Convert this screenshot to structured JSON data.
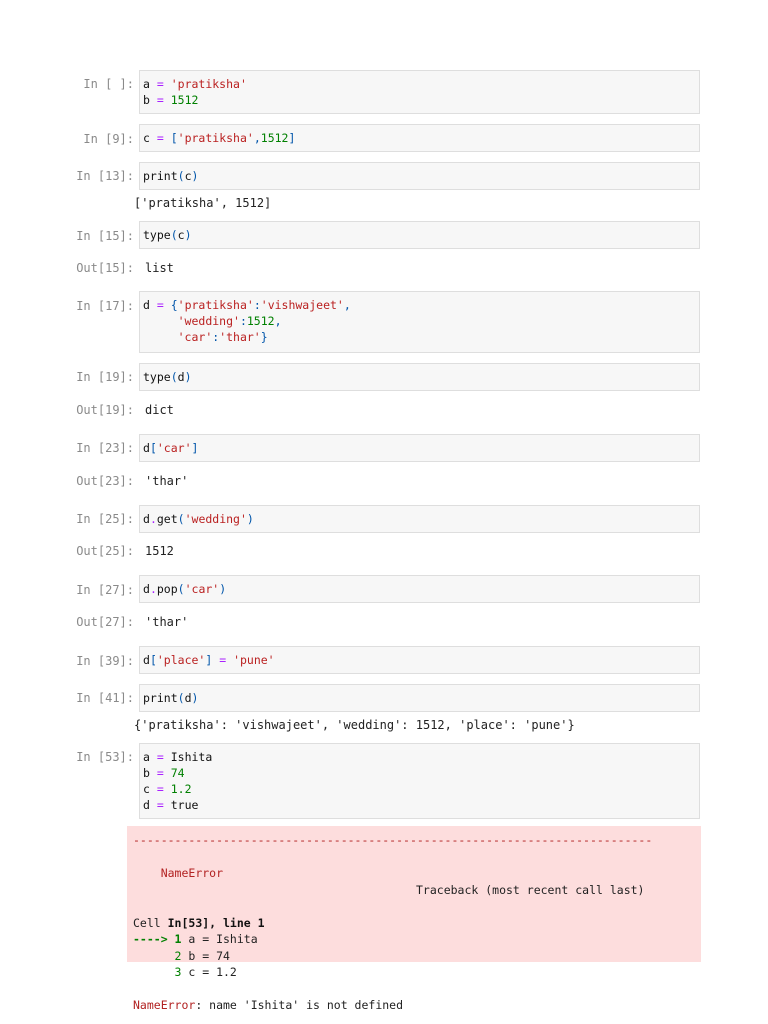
{
  "cells": [
    {
      "id": "c1",
      "prompt": "In [ ]:",
      "lines": [
        [
          {
            "t": "a",
            "c": "var"
          },
          {
            "t": " = ",
            "c": "op"
          },
          {
            "t": "'pratiksha'",
            "c": "str"
          }
        ],
        [
          {
            "t": "b",
            "c": "var"
          },
          {
            "t": " = ",
            "c": "op"
          },
          {
            "t": "1512",
            "c": "num"
          }
        ]
      ]
    },
    {
      "id": "c2",
      "prompt": "In [9]:",
      "lines": [
        [
          {
            "t": "c",
            "c": "var"
          },
          {
            "t": " = ",
            "c": "op"
          },
          {
            "t": "[",
            "c": "punc"
          },
          {
            "t": "'pratiksha'",
            "c": "str"
          },
          {
            "t": ",",
            "c": "punc"
          },
          {
            "t": "1512",
            "c": "num"
          },
          {
            "t": "]",
            "c": "punc"
          }
        ]
      ]
    },
    {
      "id": "c3",
      "prompt": "In [13]:",
      "lines": [
        [
          {
            "t": "print",
            "c": "fn"
          },
          {
            "t": "(",
            "c": "punc"
          },
          {
            "t": "c",
            "c": "var"
          },
          {
            "t": ")",
            "c": "punc"
          }
        ]
      ],
      "output": "['pratiksha', 1512]"
    },
    {
      "id": "c4",
      "prompt": "In [15]:",
      "lines": [
        [
          {
            "t": "type",
            "c": "fn"
          },
          {
            "t": "(",
            "c": "punc"
          },
          {
            "t": "c",
            "c": "var"
          },
          {
            "t": ")",
            "c": "punc"
          }
        ]
      ],
      "out_prompt": "Out[15]:",
      "output": "list"
    },
    {
      "id": "c5",
      "prompt": "In [17]:",
      "lines": [
        [
          {
            "t": "d",
            "c": "var"
          },
          {
            "t": " = ",
            "c": "op"
          },
          {
            "t": "{",
            "c": "punc"
          },
          {
            "t": "'pratiksha'",
            "c": "str"
          },
          {
            "t": ":",
            "c": "punc"
          },
          {
            "t": "'vishwajeet'",
            "c": "str"
          },
          {
            "t": ",",
            "c": "punc"
          }
        ],
        [
          {
            "t": "     ",
            "c": "var"
          },
          {
            "t": "'wedding'",
            "c": "str"
          },
          {
            "t": ":",
            "c": "punc"
          },
          {
            "t": "1512",
            "c": "num"
          },
          {
            "t": ",",
            "c": "punc"
          }
        ],
        [
          {
            "t": "     ",
            "c": "var"
          },
          {
            "t": "'car'",
            "c": "str"
          },
          {
            "t": ":",
            "c": "punc"
          },
          {
            "t": "'thar'",
            "c": "str"
          },
          {
            "t": "}",
            "c": "punc"
          }
        ]
      ]
    },
    {
      "id": "c6",
      "prompt": "In [19]:",
      "lines": [
        [
          {
            "t": "type",
            "c": "fn"
          },
          {
            "t": "(",
            "c": "punc"
          },
          {
            "t": "d",
            "c": "var"
          },
          {
            "t": ")",
            "c": "punc"
          }
        ]
      ],
      "out_prompt": "Out[19]:",
      "output": "dict"
    },
    {
      "id": "c7",
      "prompt": "In [23]:",
      "lines": [
        [
          {
            "t": "d",
            "c": "var"
          },
          {
            "t": "[",
            "c": "punc"
          },
          {
            "t": "'car'",
            "c": "str"
          },
          {
            "t": "]",
            "c": "punc"
          }
        ]
      ],
      "out_prompt": "Out[23]:",
      "output": "'thar'"
    },
    {
      "id": "c8",
      "prompt": "In [25]:",
      "lines": [
        [
          {
            "t": "d",
            "c": "var"
          },
          {
            "t": ".",
            "c": "op"
          },
          {
            "t": "get",
            "c": "fn"
          },
          {
            "t": "(",
            "c": "punc"
          },
          {
            "t": "'wedding'",
            "c": "str"
          },
          {
            "t": ")",
            "c": "punc"
          }
        ]
      ],
      "out_prompt": "Out[25]:",
      "output": "1512"
    },
    {
      "id": "c9",
      "prompt": "In [27]:",
      "lines": [
        [
          {
            "t": "d",
            "c": "var"
          },
          {
            "t": ".",
            "c": "op"
          },
          {
            "t": "pop",
            "c": "fn"
          },
          {
            "t": "(",
            "c": "punc"
          },
          {
            "t": "'car'",
            "c": "str"
          },
          {
            "t": ")",
            "c": "punc"
          }
        ]
      ],
      "out_prompt": "Out[27]:",
      "output": "'thar'"
    },
    {
      "id": "c10",
      "prompt": "In [39]:",
      "lines": [
        [
          {
            "t": "d",
            "c": "var"
          },
          {
            "t": "[",
            "c": "punc"
          },
          {
            "t": "'place'",
            "c": "str"
          },
          {
            "t": "]",
            "c": "punc"
          },
          {
            "t": " = ",
            "c": "op"
          },
          {
            "t": "'pune'",
            "c": "str"
          }
        ]
      ]
    },
    {
      "id": "c11",
      "prompt": "In [41]:",
      "lines": [
        [
          {
            "t": "print",
            "c": "fn"
          },
          {
            "t": "(",
            "c": "punc"
          },
          {
            "t": "d",
            "c": "var"
          },
          {
            "t": ")",
            "c": "punc"
          }
        ]
      ],
      "output": "{'pratiksha': 'vishwajeet', 'wedding': 1512, 'place': 'pune'}"
    },
    {
      "id": "c12",
      "prompt": "In [53]:",
      "lines": [
        [
          {
            "t": "a",
            "c": "var"
          },
          {
            "t": " = ",
            "c": "op"
          },
          {
            "t": "Ishita",
            "c": "var"
          }
        ],
        [
          {
            "t": "b",
            "c": "var"
          },
          {
            "t": " = ",
            "c": "op"
          },
          {
            "t": "74",
            "c": "num"
          }
        ],
        [
          {
            "t": "c",
            "c": "var"
          },
          {
            "t": " = ",
            "c": "op"
          },
          {
            "t": "1.2",
            "c": "num"
          }
        ],
        [
          {
            "t": "d",
            "c": "var"
          },
          {
            "t": " = ",
            "c": "op"
          },
          {
            "t": "true",
            "c": "var"
          }
        ]
      ]
    }
  ],
  "error": {
    "dashes": "---------------------------------------------------------------------------",
    "name": "NameError",
    "traceback_label": "Traceback (most recent call last)",
    "cell_prefix": "Cell ",
    "cell_ref": "In[53], line 1",
    "arrow": "----> 1",
    "line1": " a = Ishita",
    "ln2": "      2",
    "line2": " b = 74",
    "ln3": "      3",
    "line3": " c = 1.2",
    "final_name": "NameError",
    "final_msg": ": name 'Ishita' is not defined"
  }
}
